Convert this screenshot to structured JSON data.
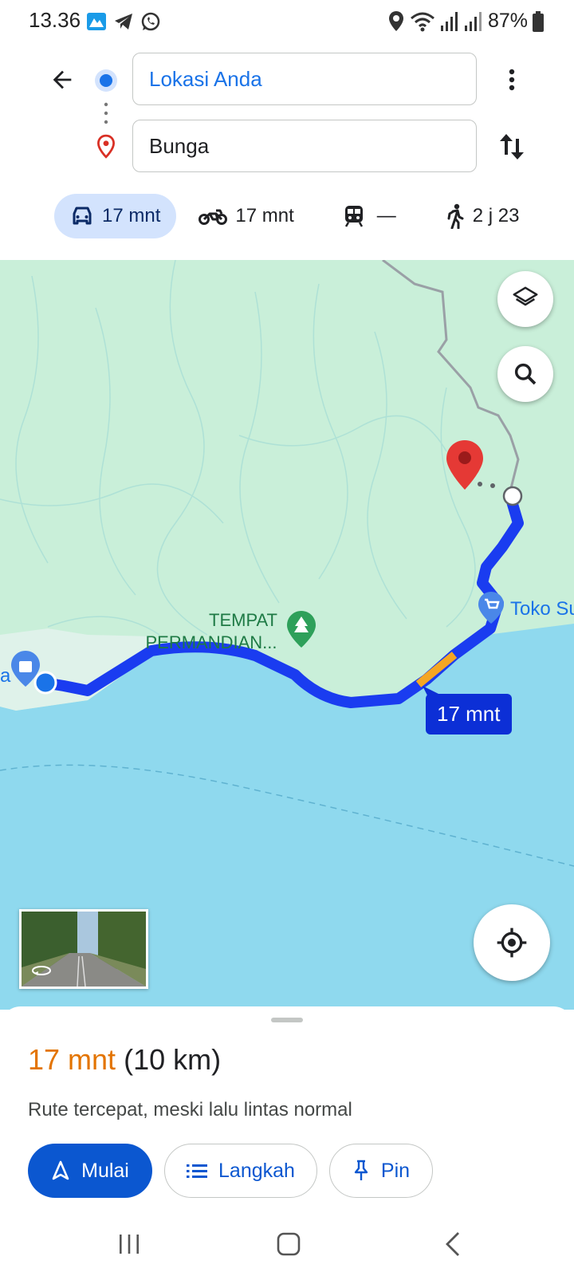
{
  "status_bar": {
    "time": "13.36",
    "battery": "87%",
    "left_icons": [
      "maps-notification-icon",
      "telegram-icon",
      "whatsapp-icon"
    ],
    "right_icons": [
      "location-icon",
      "wifi-icon",
      "signal-icon",
      "signal-icon-2",
      "battery-icon"
    ]
  },
  "directions": {
    "origin": "Lokasi Anda",
    "destination": "Bunga",
    "colors": {
      "origin_text": "#1a73e8",
      "destination_pin": "#d93025"
    }
  },
  "modes": [
    {
      "name": "car",
      "label": "17 mnt",
      "selected": true
    },
    {
      "name": "motorcycle",
      "label": "17 mnt",
      "selected": false
    },
    {
      "name": "transit",
      "label": "—",
      "selected": false
    },
    {
      "name": "walk",
      "label": "2 j 23",
      "selected": false
    }
  ],
  "map": {
    "labels": {
      "place_1_line1": "TEMPAT",
      "place_1_line2": "PERMANDIAN...",
      "shop": "Toko Su",
      "shop_left": "a"
    },
    "route_badge": "17 mnt",
    "colors": {
      "land": "#c9efd9",
      "water": "#8fd9ee",
      "route": "#1a3cf0",
      "traffic_moderate": "#f5a623",
      "destination_pin": "#e53935"
    }
  },
  "summary": {
    "duration": "17 mnt",
    "distance": "(10 km)",
    "note": "Rute tercepat, meski lalu lintas normal",
    "colors": {
      "duration": "#e37400"
    }
  },
  "actions": {
    "start": "Mulai",
    "steps": "Langkah",
    "pin": "Pin"
  },
  "nav_bar": [
    "recents-icon",
    "home-icon",
    "back-icon"
  ]
}
